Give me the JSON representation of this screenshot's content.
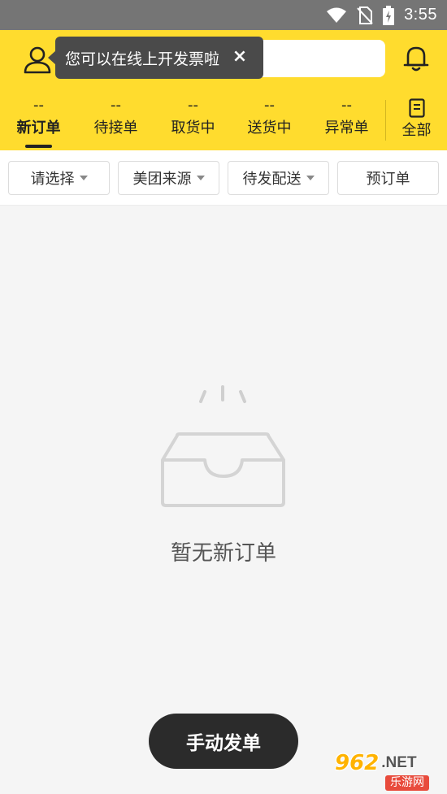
{
  "status_bar": {
    "time": "3:55"
  },
  "header": {
    "tooltip_text": "您可以在线上开发票啦",
    "tooltip_close": "×"
  },
  "tabs": [
    {
      "count": "--",
      "label": "新订单",
      "active": true
    },
    {
      "count": "--",
      "label": "待接单"
    },
    {
      "count": "--",
      "label": "取货中"
    },
    {
      "count": "--",
      "label": "送货中"
    },
    {
      "count": "--",
      "label": "异常单"
    }
  ],
  "tab_all": {
    "label": "全部"
  },
  "filters": [
    {
      "label": "请选择",
      "dropdown": true
    },
    {
      "label": "美团来源",
      "dropdown": true
    },
    {
      "label": "待发配送",
      "dropdown": true
    },
    {
      "label": "预订单",
      "dropdown": false
    }
  ],
  "empty_state": {
    "text": "暂无新订单"
  },
  "manual_button": {
    "label": "手动发单"
  },
  "watermark": {
    "brand_number": "962",
    "brand_suffix": ".NET",
    "brand_sub": "乐游网"
  },
  "colors": {
    "header_bg": "#ffdc2e",
    "status_bar": "#757575",
    "button_bg": "#2b2b2b",
    "tooltip_bg": "#4a4a4a"
  }
}
